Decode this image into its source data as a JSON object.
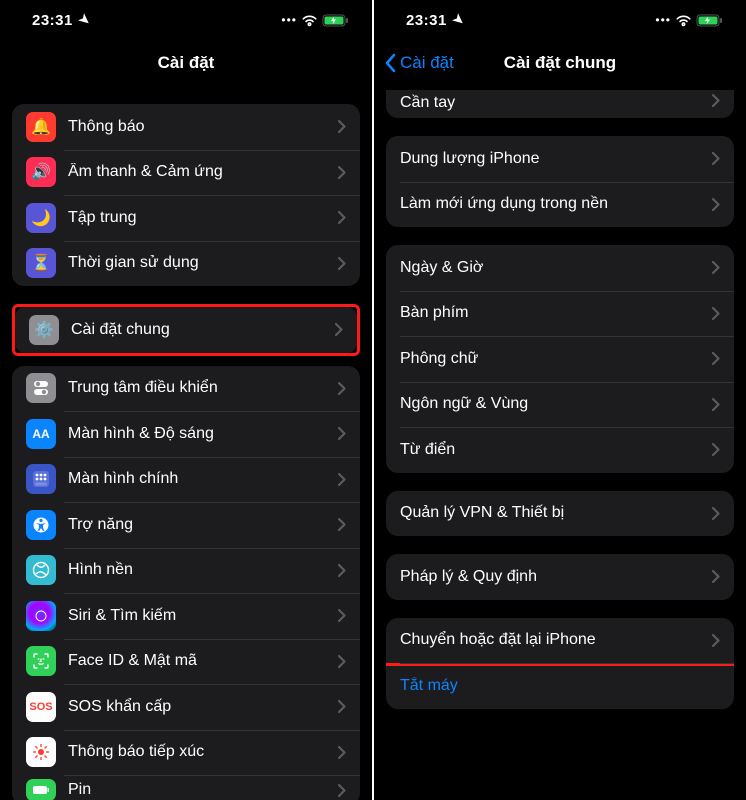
{
  "left": {
    "status": {
      "time": "23:31"
    },
    "title": "Cài đặt",
    "groupA": [
      {
        "label": "Thông báo",
        "iconName": "notification-icon",
        "bg": "#ff3b30"
      },
      {
        "label": "Âm thanh & Cảm ứng",
        "iconName": "sound-icon",
        "bg": "#ff2d55"
      },
      {
        "label": "Tập trung",
        "iconName": "focus-icon",
        "bg": "#5856d6"
      },
      {
        "label": "Thời gian sử dụng",
        "iconName": "screentime-icon",
        "bg": "#5856d6"
      }
    ],
    "highlight": {
      "label": "Cài đặt chung",
      "iconName": "general-icon",
      "bg": "#8e8e93"
    },
    "groupB": [
      {
        "label": "Trung tâm điều khiển",
        "iconName": "control-center-icon",
        "bg": "#8e8e93"
      },
      {
        "label": "Màn hình & Độ sáng",
        "iconName": "display-icon",
        "bg": "#0a84ff"
      },
      {
        "label": "Màn hình chính",
        "iconName": "homescreen-icon",
        "bg": "#3955c7"
      },
      {
        "label": "Trợ năng",
        "iconName": "accessibility-icon",
        "bg": "#0a84ff"
      },
      {
        "label": "Hình nền",
        "iconName": "wallpaper-icon",
        "bg": "#33bcd1"
      },
      {
        "label": "Siri & Tìm kiếm",
        "iconName": "siri-icon",
        "bg": "#1e1e28"
      },
      {
        "label": "Face ID & Mật mã",
        "iconName": "faceid-icon",
        "bg": "#30d158"
      },
      {
        "label": "SOS khẩn cấp",
        "iconName": "sos-icon",
        "bg": "#ffffff"
      },
      {
        "label": "Thông báo tiếp xúc",
        "iconName": "exposure-icon",
        "bg": "#ff3b30"
      },
      {
        "label": "Pin",
        "iconName": "battery-icon",
        "bg": "#30d158"
      }
    ]
  },
  "right": {
    "status": {
      "time": "23:31"
    },
    "back": "Cài đặt",
    "title": "Cài đặt chung",
    "groupTop": [
      {
        "label": "Cần tay"
      }
    ],
    "groupA": [
      {
        "label": "Dung lượng iPhone"
      },
      {
        "label": "Làm mới ứng dụng trong nền"
      }
    ],
    "groupB": [
      {
        "label": "Ngày & Giờ"
      },
      {
        "label": "Bàn phím"
      },
      {
        "label": "Phông chữ"
      },
      {
        "label": "Ngôn ngữ & Vùng"
      },
      {
        "label": "Từ điển"
      }
    ],
    "groupC": [
      {
        "label": "Quản lý VPN & Thiết bị"
      }
    ],
    "groupD": [
      {
        "label": "Pháp lý & Quy định"
      }
    ],
    "groupE": {
      "transfer": "Chuyển hoặc đặt lại iPhone",
      "shutdown": "Tắt máy"
    }
  }
}
